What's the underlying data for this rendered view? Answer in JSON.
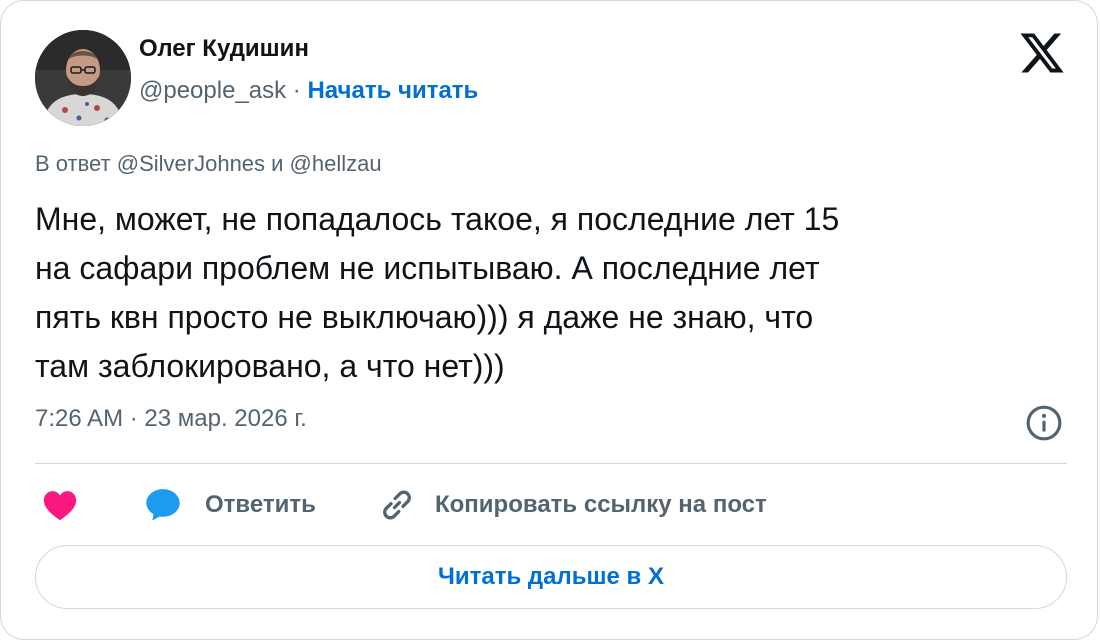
{
  "author": {
    "name": "Олег Кудишин",
    "handle": "@people_ask",
    "separator": " · ",
    "follow_label": "Начать читать"
  },
  "icons": {
    "platform_logo": "x-logo-icon",
    "info": "info-icon",
    "like": "heart-icon",
    "reply": "speech-bubble-icon",
    "copy_link": "link-icon"
  },
  "tweet": {
    "reply_context": "В ответ @SilverJohnes и @hellzau",
    "text_lines": [
      "Мне, может, не попадалось такое, я последние лет 15",
      "на сафари проблем не испытываю. А последние лет",
      "пять квн просто не выключаю))) я даже не знаю, что",
      "там заблокировано, а что нет)))"
    ],
    "timestamp": "7:26 AM · 23 мар. 2026 г."
  },
  "actions": {
    "reply_label": "Ответить",
    "copy_link_label": "Копировать ссылку на пост"
  },
  "footer": {
    "read_more_label": "Читать дальше в X"
  },
  "colors": {
    "accent": "#006fd6",
    "like": "#f91880",
    "reply": "#1d9bf0",
    "text_primary": "#0f1419",
    "text_secondary": "#536471",
    "border": "#cfd9de"
  }
}
